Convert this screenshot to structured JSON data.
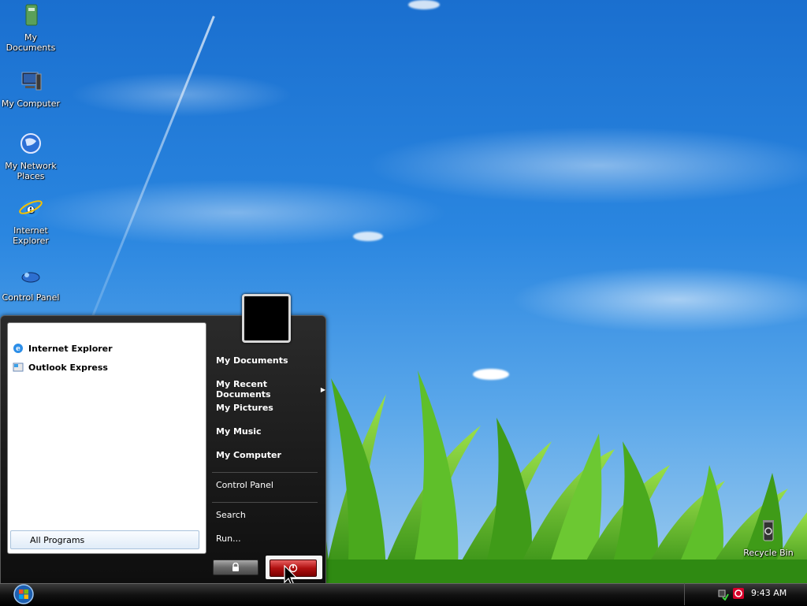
{
  "desktop_icons": [
    {
      "id": "my-documents",
      "label": "My\nDocuments",
      "icon": "folder-icon"
    },
    {
      "id": "my-computer",
      "label": "My Computer",
      "icon": "computer-icon"
    },
    {
      "id": "my-network-places",
      "label": "My Network\nPlaces",
      "icon": "globe-icon"
    },
    {
      "id": "internet-explorer",
      "label": "Internet\nExplorer",
      "icon": "ie-icon"
    },
    {
      "id": "control-panel",
      "label": "Control Panel",
      "icon": "control-panel-icon"
    },
    {
      "id": "recycle-bin",
      "label": "Recycle Bin",
      "icon": "recycle-bin-icon"
    }
  ],
  "start_menu": {
    "pinned": [
      {
        "label": "Internet Explorer",
        "icon": "ie-icon"
      },
      {
        "label": "Outlook Express",
        "icon": "outlook-icon"
      }
    ],
    "all_programs": "All Programs",
    "right_items": [
      {
        "label": "My Documents"
      },
      {
        "label": "My Recent Documents",
        "submenu": true
      },
      {
        "label": "My Pictures"
      },
      {
        "label": "My Music"
      },
      {
        "label": "My Computer"
      },
      {
        "label": "Control Panel"
      },
      {
        "label": "Search"
      },
      {
        "label": "Run..."
      }
    ]
  },
  "taskbar": {
    "clock": "9:43 AM"
  },
  "colors": {
    "sky": "#2a86e0",
    "grass": "#5fbf2a",
    "power_button": "#b01010",
    "taskbar": "#111111"
  }
}
